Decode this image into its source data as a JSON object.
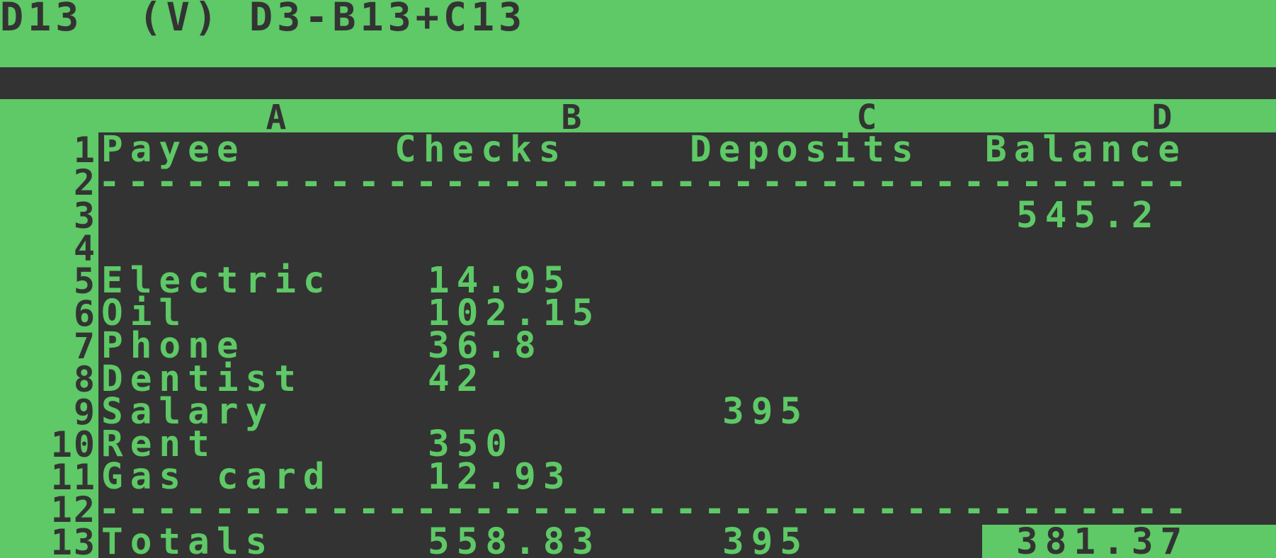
{
  "app": "VisiCalc",
  "status": {
    "current_cell": "D13",
    "value_type": "(V)",
    "formula": "D3-B13+C13"
  },
  "prompt_line": "",
  "columns": [
    "A",
    "B",
    "C",
    "D"
  ],
  "rows": [
    "1",
    "2",
    "3",
    "4",
    "5",
    "6",
    "7",
    "8",
    "9",
    "10",
    "11",
    "12",
    "13"
  ],
  "cells": {
    "A1": "Payee",
    "B1": "Checks",
    "C1": "Deposits",
    "D1": "Balance",
    "A2": "--------------------------------------",
    "D3": "545.2",
    "A5": "Electric",
    "B5": "14.95",
    "A6": "Oil",
    "B6": "102.15",
    "A7": "Phone",
    "B7": "36.8",
    "A8": "Dentist",
    "B8": "42",
    "A9": "Salary",
    "C9": "395",
    "A10": "Rent",
    "B10": "350",
    "A11": "Gas card",
    "B11": "12.93",
    "A12": "--------------------------------------",
    "A13": "Totals",
    "B13": "558.83",
    "C13": "395",
    "D13": "381.37"
  },
  "colors": {
    "green": "#5ec966",
    "dark": "#333333"
  }
}
